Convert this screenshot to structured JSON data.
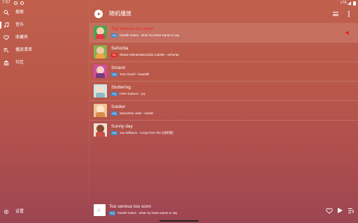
{
  "status": {
    "time": "7:07",
    "network": "LTE"
  },
  "sidebar": {
    "items": [
      {
        "label": "搜索",
        "icon": "search-icon"
      },
      {
        "label": "音乐",
        "icon": "music-icon",
        "active": true
      },
      {
        "label": "收藏夹",
        "icon": "heart-icon"
      },
      {
        "label": "播放清单",
        "icon": "playlist-icon"
      },
      {
        "label": "社区",
        "icon": "community-icon"
      }
    ],
    "settings_label": "设置"
  },
  "header": {
    "title": "随机播放"
  },
  "songs": [
    {
      "title": "Too serious too soon",
      "artist_album": "Gareth Gates - what my heart wants to say",
      "quality": "HQ",
      "current": true
    },
    {
      "title": "Señorita",
      "artist_album": "Shawn Mendes&Camila Cabello - señorita",
      "quality": "SQ"
    },
    {
      "title": "Smash",
      "artist_album": "Tone Damli - heartkill",
      "quality": "HQ"
    },
    {
      "title": "Stuttering",
      "artist_album": "Fefe+Dobson - joy",
      "quality": "HQ"
    },
    {
      "title": "Soldier",
      "artist_album": "Samantha Jade - soldier",
      "quality": "HQ"
    },
    {
      "title": "Sunny day",
      "artist_album": "Joy Williams - songs from this [试听版]",
      "quality": "HQ"
    }
  ],
  "now_playing": {
    "title": "Too serious too soon",
    "artist_album": "Gareth Gates - what my heart wants to say",
    "quality": "HQ"
  },
  "colors": {
    "accent": "#e8251d",
    "hq_badge": "#3f86c6",
    "sq_badge": "#e8251d"
  }
}
